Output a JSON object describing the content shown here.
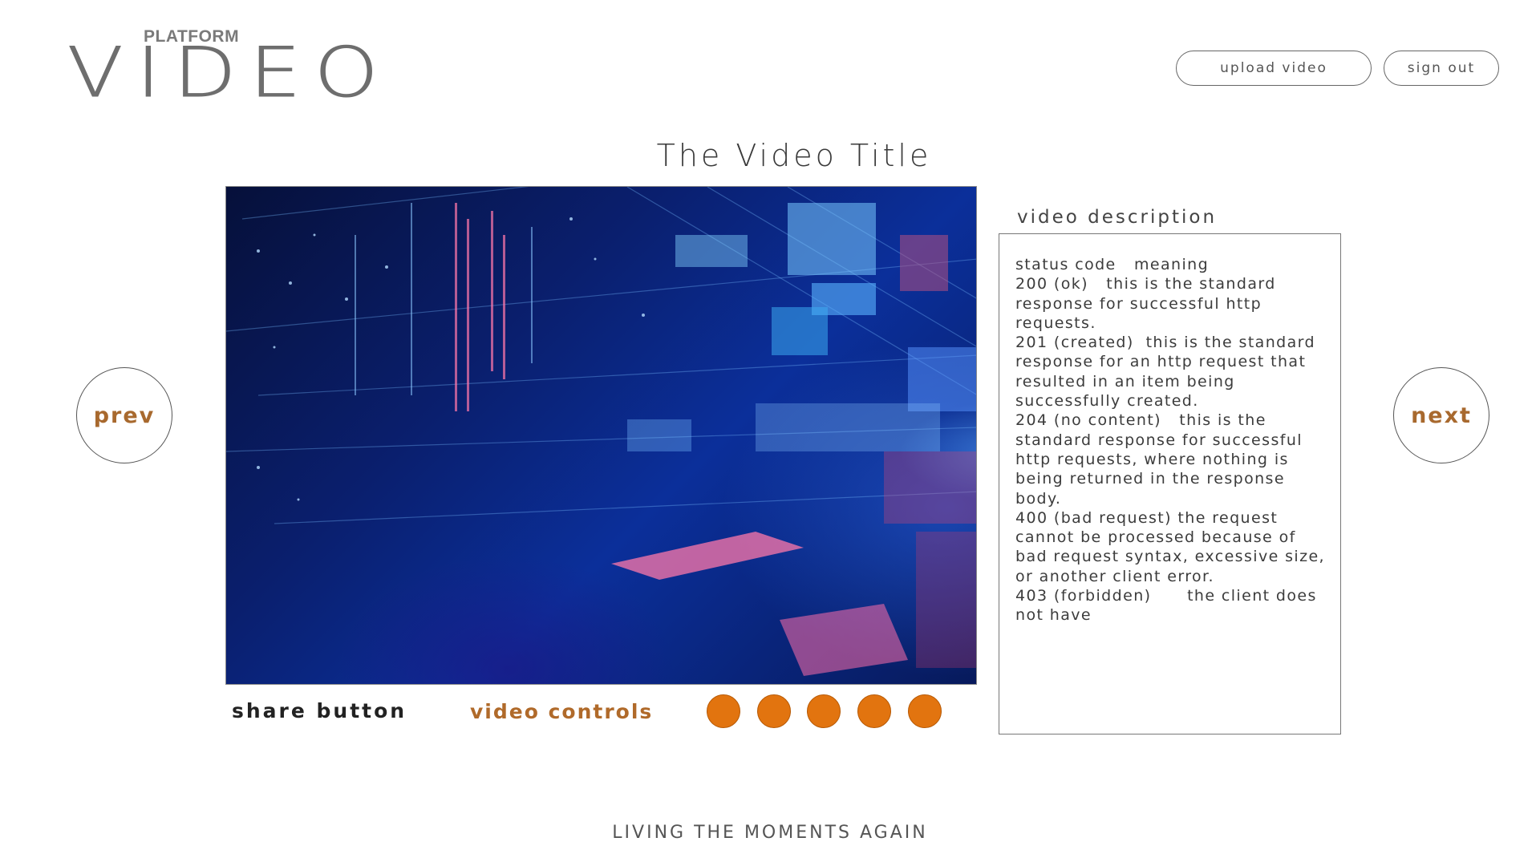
{
  "header": {
    "logo_small": "PLATFORM",
    "logo_big": "VIDEO",
    "upload_label": "upload video",
    "signout_label": "sign out"
  },
  "main": {
    "title": "The Video Title",
    "share_label": "share button",
    "controls_label": "video controls",
    "prev_label": "prev",
    "next_label": "next"
  },
  "description": {
    "heading": "video description",
    "text": "Status code   Meaning\n200 (OK)   This is the standard response for successful HTTP requests.\n201 (CREATED)  This is the standard response for an HTTP request that resulted in an item being successfully created.\n204 (NO CONTENT)   This is the standard response for successful HTTP requests, where nothing is being returned in the response body.\n400 (BAD REQUEST) The request cannot be processed because of bad request syntax, excessive size, or another client error.\n403 (FORBIDDEN)      The client does not have"
  },
  "footer": {
    "tagline": "LIVING THE MOMENTS AGAIN"
  },
  "colors": {
    "accent": "#e2740f",
    "accent_text": "#b06a2a",
    "text_dark": "#3a3a3a"
  },
  "icons": {
    "control_dots": [
      "control-dot",
      "control-dot",
      "control-dot",
      "control-dot",
      "control-dot"
    ]
  }
}
